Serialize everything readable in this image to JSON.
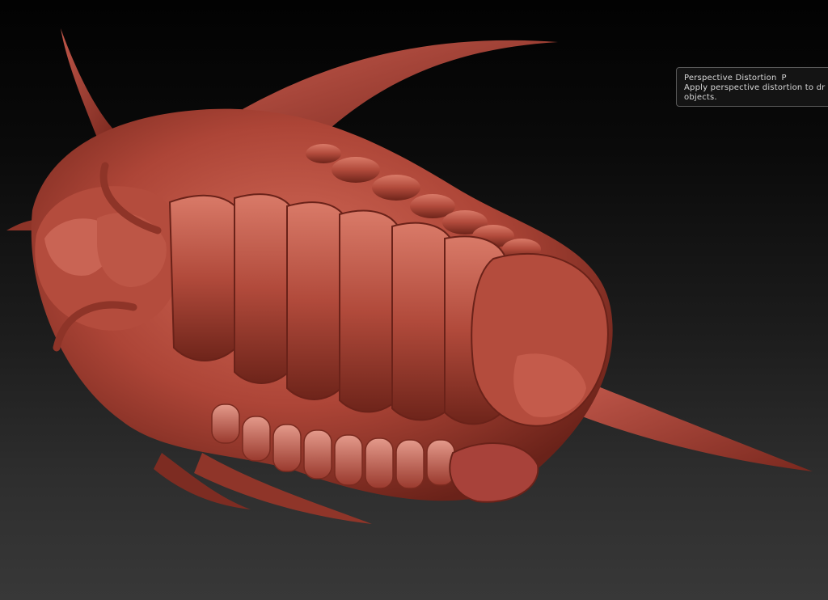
{
  "tooltip": {
    "title": "Perspective Distortion",
    "shortcut": "P",
    "description_line1": "Apply perspective distortion to dr",
    "description_line2": "objects."
  },
  "model": {
    "name": "trilobite-sculpt-icon",
    "material_color": "#b0483a"
  },
  "colors": {
    "background_top": "#020202",
    "background_bottom": "#383838",
    "material_base": "#b0483a",
    "material_shadow": "#5e1e16",
    "material_highlight": "#e08f80"
  }
}
